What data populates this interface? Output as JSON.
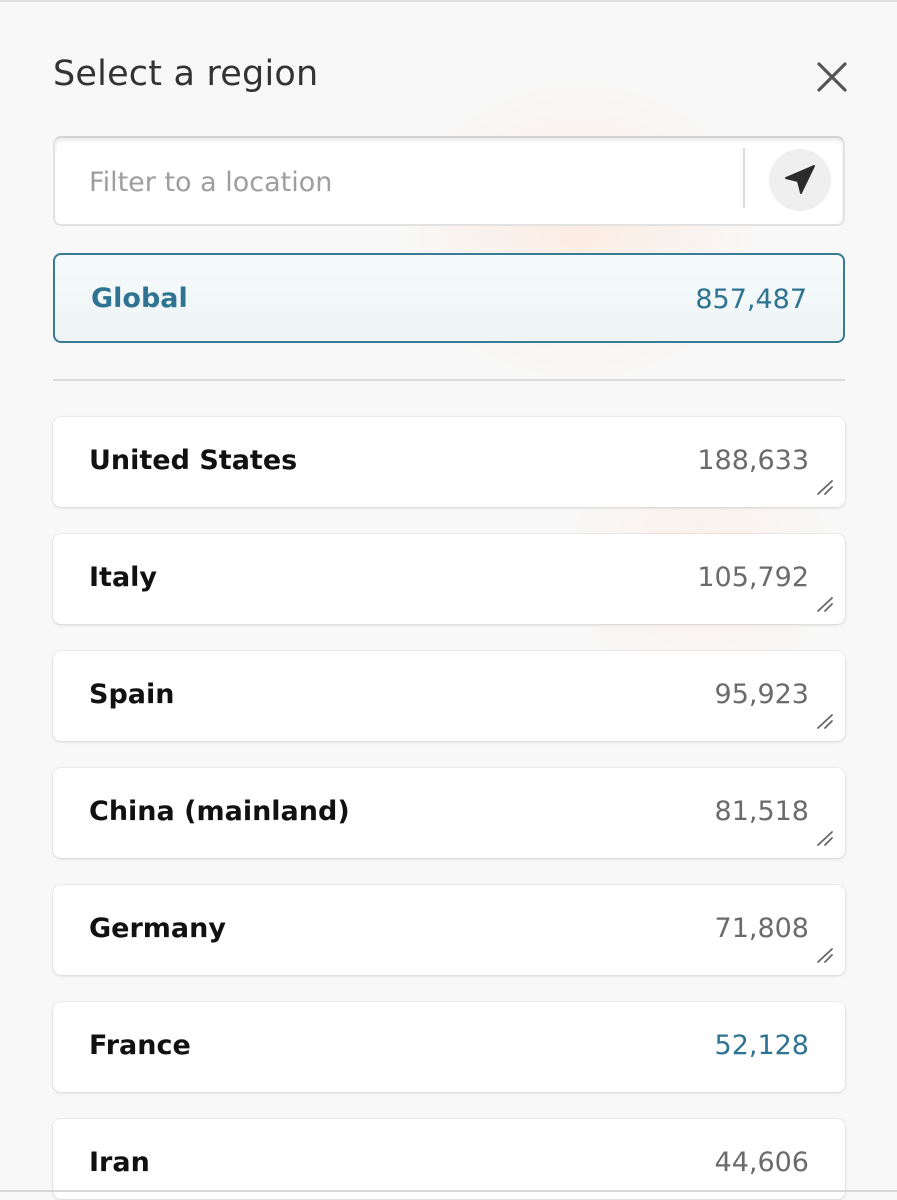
{
  "header": {
    "title": "Select a region"
  },
  "search": {
    "placeholder": "Filter to a location",
    "value": ""
  },
  "global": {
    "label": "Global",
    "count": "857,487"
  },
  "regions": [
    {
      "name": "United States",
      "count": "188,633",
      "trend_icon": "trend-icon"
    },
    {
      "name": "Italy",
      "count": "105,792",
      "trend_icon": "trend-icon"
    },
    {
      "name": "Spain",
      "count": "95,923",
      "trend_icon": "trend-icon"
    },
    {
      "name": "China (mainland)",
      "count": "81,518",
      "trend_icon": "trend-icon"
    },
    {
      "name": "Germany",
      "count": "71,808",
      "trend_icon": "trend-icon"
    },
    {
      "name": "France",
      "count": "52,128"
    },
    {
      "name": "Iran",
      "count": "44,606"
    }
  ],
  "colors": {
    "accent": "#2f7392",
    "selected_border": "#3a7b94",
    "title_text": "#333333",
    "count_text": "#6b6b6b"
  }
}
